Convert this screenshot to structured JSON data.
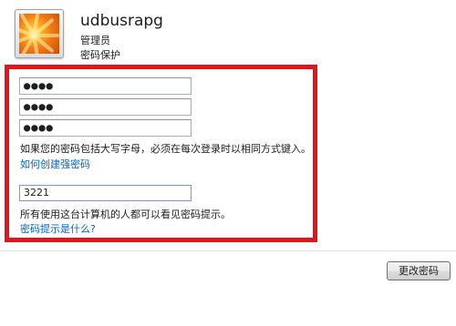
{
  "user": {
    "name": "udbusrapg",
    "role": "管理员",
    "protection": "密码保护"
  },
  "form": {
    "new_password": "●●●●",
    "confirm_password": "●●●●",
    "current_password": "●●●●",
    "caps_warning": "如果您的密码包括大写字母，必须在每次登录时以相同方式键入。",
    "strong_password_link": "如何创建强密码",
    "hint_value": "3221",
    "hint_notice": "所有使用这台计算机的人都可以看见密码提示。",
    "hint_help_link": "密码提示是什么?"
  },
  "actions": {
    "change_password_label": "更改密码"
  },
  "colors": {
    "highlight_border": "#e0161c",
    "link": "#0066cc"
  }
}
